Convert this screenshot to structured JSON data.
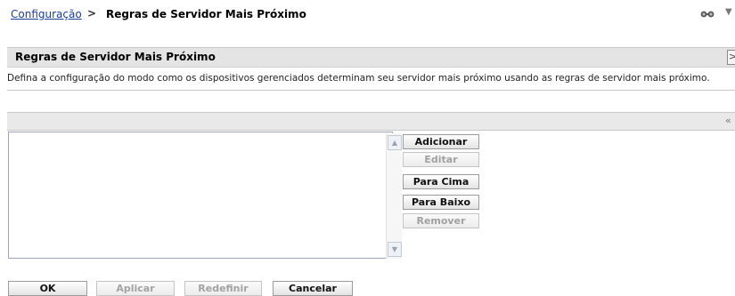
{
  "breadcrumb": {
    "parent": "Configuração",
    "separator": ">",
    "current": "Regras de Servidor Mais Próximo"
  },
  "toolbar": {
    "icons": [
      "glasses-icon",
      "caret-down-icon"
    ],
    "caret": "▼"
  },
  "panel": {
    "title": "Regras de Servidor Mais Próximo",
    "close_glyph": ">",
    "description": "Defina a configuração do modo como os dispositivos gerenciados determinam seu servidor mais próximo usando as regras de servidor mais próximo."
  },
  "rules": {
    "collapse_glyph": "«",
    "items": [],
    "buttons": {
      "add": "Adicionar",
      "edit": "Editar",
      "move_up": "Para Cima",
      "move_down": "Para Baixo",
      "remove": "Remover"
    },
    "disabled": [
      "edit",
      "remove"
    ]
  },
  "footer": {
    "ok": "OK",
    "apply": "Aplicar",
    "reset": "Redefinir",
    "cancel": "Cancelar"
  },
  "colors": {
    "link": "#1a3f9c",
    "header_bg": "#e4e4e4",
    "disabled_text": "#a0a0a0"
  }
}
